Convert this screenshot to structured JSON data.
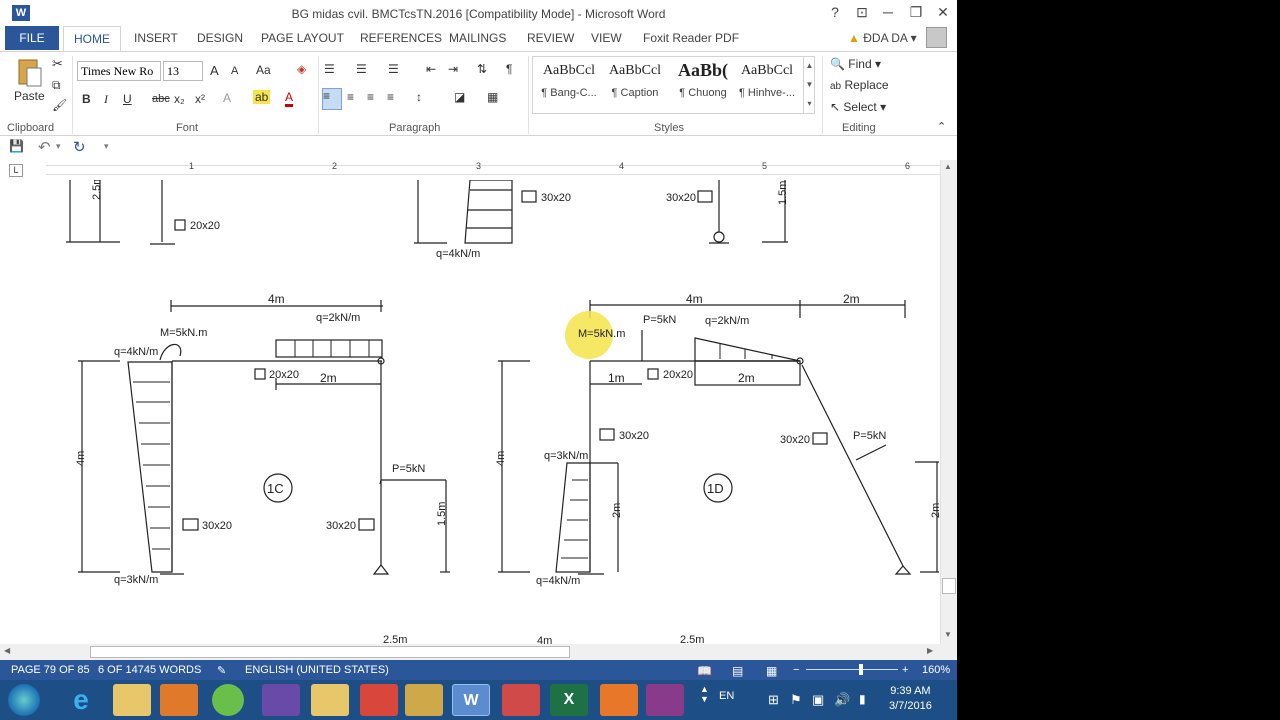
{
  "window": {
    "title": "BG midas cvil. BMCTcsTN.2016 [Compatibility Mode] - Microsoft Word",
    "controls": {
      "help": "?",
      "ribbon_options": "⊡",
      "minimize": "─",
      "restore": "❐",
      "close": "✕"
    }
  },
  "tabs": [
    "FILE",
    "HOME",
    "INSERT",
    "DESIGN",
    "PAGE LAYOUT",
    "REFERENCES",
    "MAILINGS",
    "REVIEW",
    "VIEW",
    "Foxit Reader PDF"
  ],
  "user": {
    "name": "ĐDA DA",
    "icon": "warning-icon"
  },
  "ribbon": {
    "clipboard": {
      "label": "Clipboard",
      "paste": "Paste"
    },
    "font": {
      "label": "Font",
      "font_name": "Times New Ro",
      "font_size": "13",
      "grow": "A",
      "shrink": "A",
      "case": "Aa",
      "bold": "B",
      "italic": "I",
      "underline": "U",
      "strike": "abc",
      "sub": "x₂",
      "sup": "x²"
    },
    "paragraph": {
      "label": "Paragraph",
      "pilcrow": "¶"
    },
    "styles": {
      "label": "Styles",
      "items": [
        {
          "sample": "AaBbCcl",
          "name": "¶ Bang-C..."
        },
        {
          "sample": "AaBbCcl",
          "name": "¶ Caption"
        },
        {
          "sample": "AaBb(",
          "name": "¶ Chuong"
        },
        {
          "sample": "AaBbCcl",
          "name": "¶ Hinhve-..."
        }
      ]
    },
    "editing": {
      "label": "Editing",
      "find": "Find",
      "replace": "Replace",
      "select": "Select"
    }
  },
  "ruler": {
    "numbers": [
      "1",
      "2",
      "3",
      "4",
      "5",
      "6"
    ],
    "tab_selector": "L"
  },
  "document": {
    "top": {
      "dim_25": "2.5m",
      "sec_2020": "20x20",
      "sec_3020a": "30x20",
      "load_q4": "q=4kN/m",
      "sec_3020b": "30x20",
      "dim_15": "1.5m"
    },
    "frame_1c": {
      "label": "1C",
      "span": "4m",
      "moment": "M=5kN.m",
      "q_top": "q=2kN/m",
      "q_left_top": "q=4kN/m",
      "q_left_bottom": "q=3kN/m",
      "beam_section": "20x20",
      "sub_span": "2m",
      "height": "4m",
      "col_left": "30x20",
      "col_right": "30x20",
      "load_p": "P=5kN",
      "dim_15": "1.5m",
      "bottom_dim": "2.5m"
    },
    "frame_1d": {
      "label": "1D",
      "span": "4m",
      "span2": "2m",
      "moment": "M=5kN.m",
      "load_p": "P=5kN",
      "q_top": "q=2kN/m",
      "dim_1": "1m",
      "beam_section": "20x20",
      "sub_span": "2m",
      "col_section": "30x20",
      "q_left_top": "q=3kN/m",
      "q_left_bottom": "q=4kN/m",
      "height": "4m",
      "dim_2_left": "2m",
      "incline_section": "30x20",
      "incline_load": "P=5kN",
      "dim_2_right": "2m",
      "bottom_dim_1": "4m",
      "bottom_dim_2": "2.5m"
    }
  },
  "status": {
    "page": "PAGE 79 OF 85",
    "words": "6 OF 14745 WORDS",
    "language": "ENGLISH (UNITED STATES)",
    "zoom": "160%",
    "zoom_level": 0.6
  },
  "taskbar": {
    "lang": "EN",
    "time": "9:39 AM",
    "date": "3/7/2016"
  },
  "colors": {
    "accent": "#2b579a",
    "taskbar": "#1d4f86",
    "highlight": "#f5e44a"
  }
}
